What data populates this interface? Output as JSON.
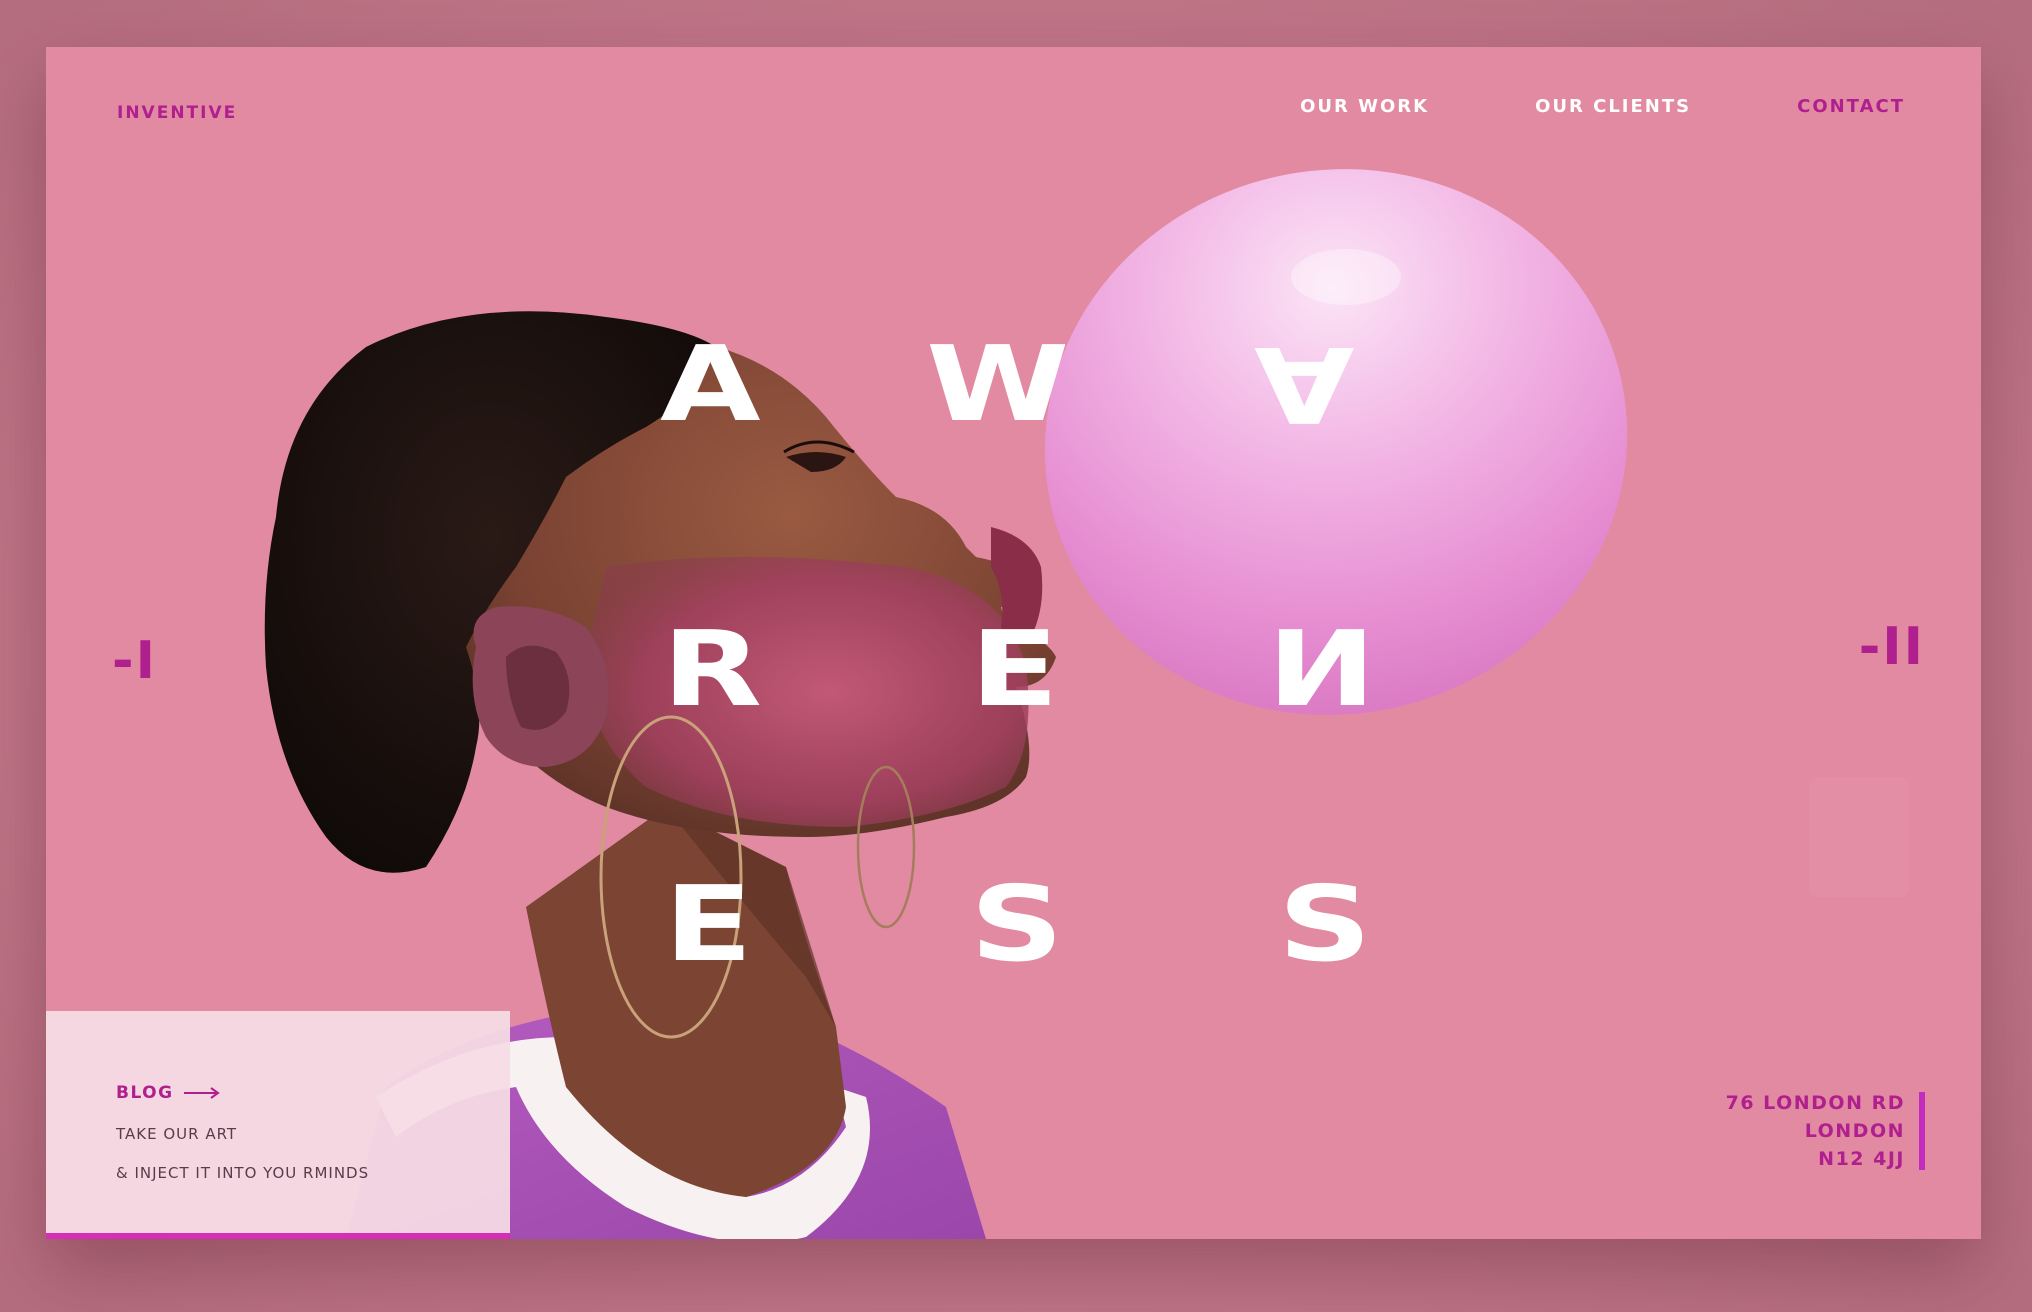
{
  "header": {
    "brand": "INVENTIVE",
    "nav": [
      {
        "label": "OUR WORK"
      },
      {
        "label": "OUR CLIENTS"
      },
      {
        "label": "CONTACT"
      }
    ]
  },
  "hero": {
    "letters": [
      "A",
      "W",
      "A",
      "R",
      "E",
      "N",
      "E",
      "S",
      "S"
    ]
  },
  "pager": {
    "left": "-I",
    "right": "-II"
  },
  "blog": {
    "label": "BLOG",
    "line1": "TAKE OUR ART",
    "line2": "& INJECT IT INTO YOU RMINDS"
  },
  "address": {
    "line1": "76 LONDON RD",
    "line2": "LONDON",
    "line3": "N12 4JJ"
  },
  "colors": {
    "background": "#e28aa2",
    "accent": "#b01f8e",
    "accent_bar": "#c42cc0",
    "bubble": "#f0a8de",
    "text_light": "#ffffff"
  }
}
